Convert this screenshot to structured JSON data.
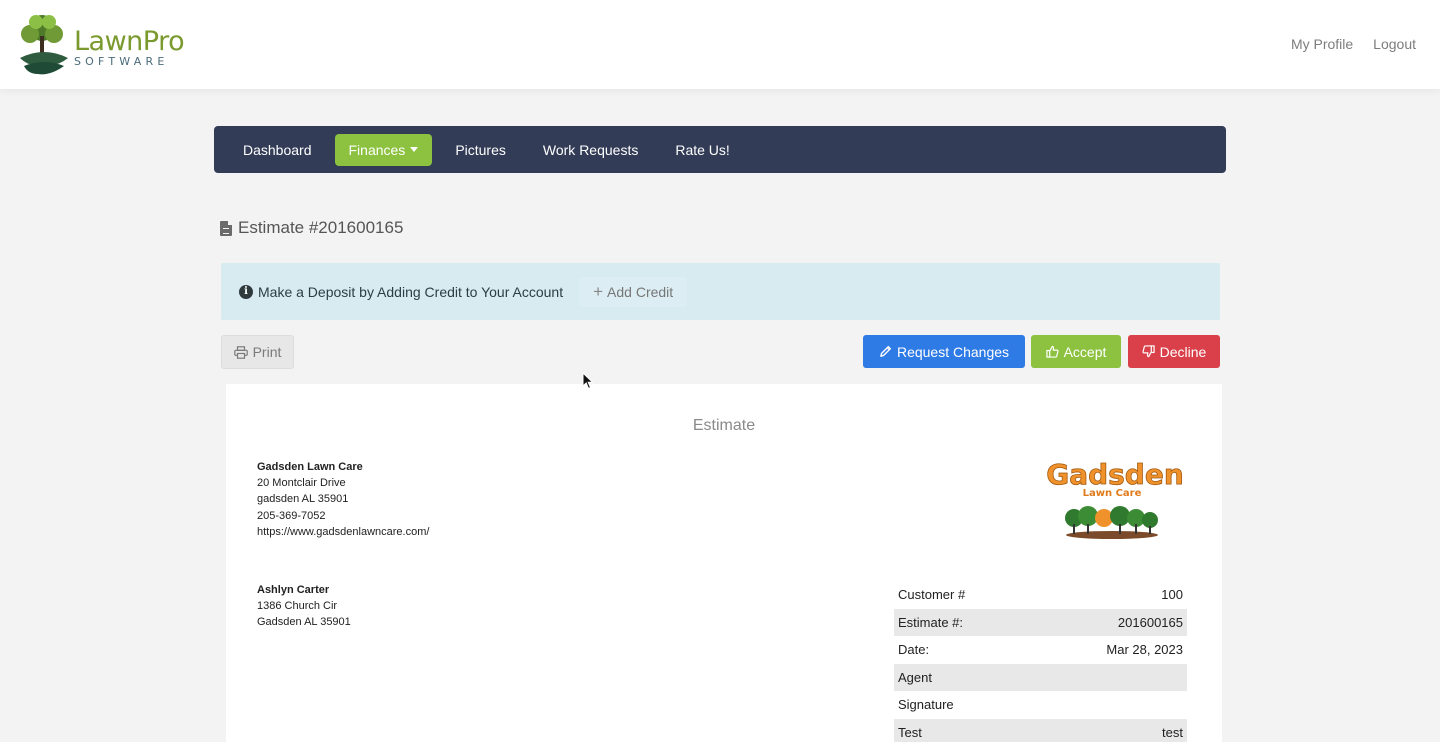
{
  "header": {
    "logo_main": "LawnPro",
    "logo_sub": "SOFTWARE",
    "links": {
      "profile": "My Profile",
      "logout": "Logout"
    }
  },
  "nav": {
    "items": [
      {
        "label": "Dashboard"
      },
      {
        "label": "Finances"
      },
      {
        "label": "Pictures"
      },
      {
        "label": "Work Requests"
      },
      {
        "label": "Rate Us!"
      }
    ]
  },
  "page": {
    "title": "Estimate #201600165"
  },
  "alert": {
    "text": "Make a Deposit by Adding Credit to Your Account",
    "add_credit": "Add Credit"
  },
  "actions": {
    "print": "Print",
    "request_changes": "Request Changes",
    "accept": "Accept",
    "decline": "Decline"
  },
  "document": {
    "heading": "Estimate",
    "company": {
      "name": "Gadsden Lawn Care",
      "street": "20 Montclair Drive",
      "city": "gadsden AL 35901",
      "phone": "205-369-7052",
      "website": "https://www.gadsdenlawncare.com/"
    },
    "company_logo": {
      "line1": "Gadsden",
      "line2": "Lawn Care"
    },
    "customer": {
      "name": "Ashlyn Carter",
      "street": "1386 Church Cir",
      "city": "Gadsden AL 35901"
    },
    "info_rows": [
      {
        "label": "Customer #",
        "value": "100"
      },
      {
        "label": "Estimate #:",
        "value": "201600165"
      },
      {
        "label": "Date:",
        "value": "Mar 28, 2023"
      },
      {
        "label": "Agent",
        "value": ""
      },
      {
        "label": "Signature",
        "value": ""
      },
      {
        "label": "Test",
        "value": "test"
      }
    ]
  },
  "colors": {
    "nav_bg": "#323c57",
    "accent_green": "#8cc23f",
    "primary_blue": "#2e7be6",
    "danger_red": "#d9404a",
    "alert_bg": "#d8ebf1"
  }
}
